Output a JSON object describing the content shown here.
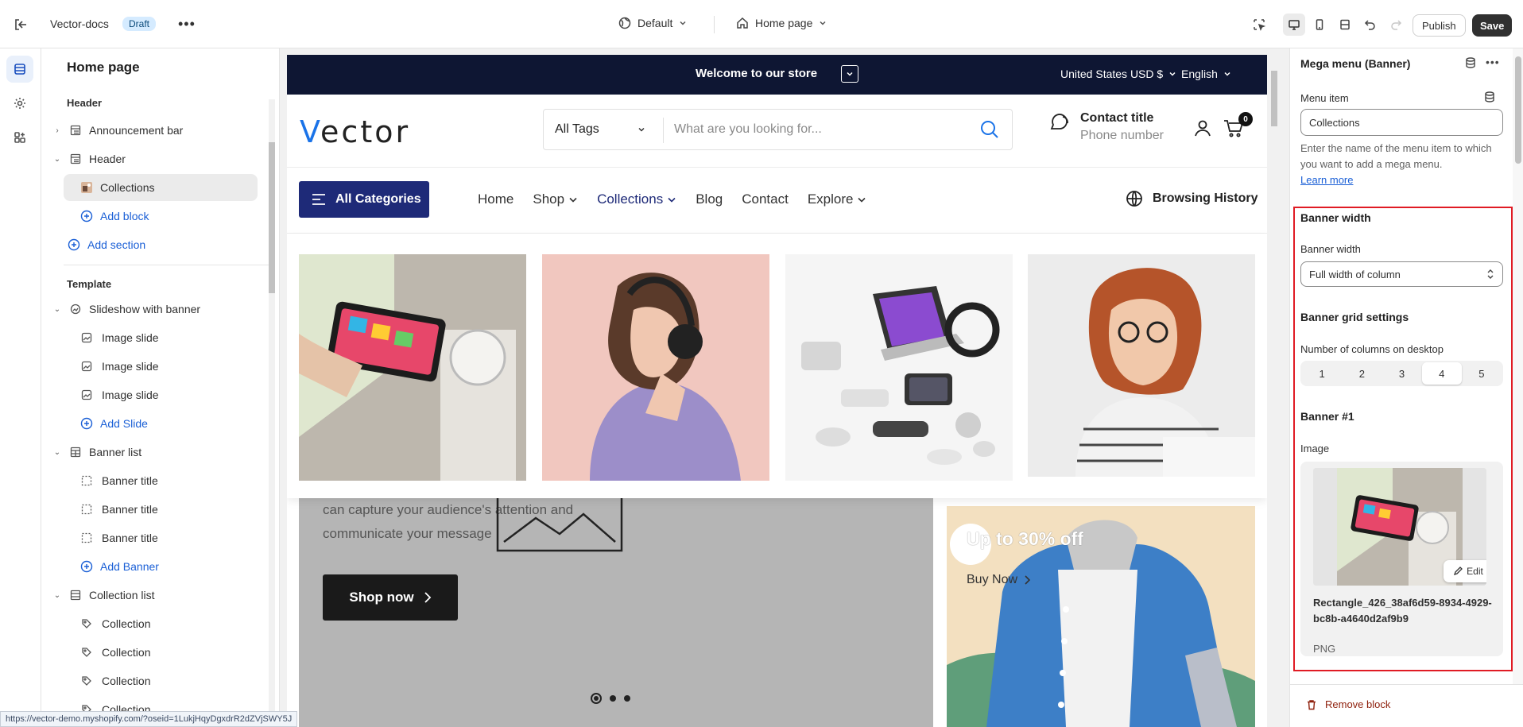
{
  "topbar": {
    "store_name": "Vector-docs",
    "status_badge": "Draft",
    "more": "•••",
    "theme": "Default",
    "page": "Home page",
    "publish_label": "Publish",
    "save_label": "Save"
  },
  "outline": {
    "title": "Home page",
    "header_group": "Header",
    "template_group": "Template",
    "items": {
      "announcement_bar": "Announcement bar",
      "header": "Header",
      "collections": "Collections",
      "add_block": "Add block",
      "add_section": "Add section",
      "slideshow": "Slideshow with banner",
      "image_slide_1": "Image slide",
      "image_slide_2": "Image slide",
      "image_slide_3": "Image slide",
      "add_slide": "Add Slide",
      "banner_list": "Banner list",
      "banner_title_1": "Banner title",
      "banner_title_2": "Banner title",
      "banner_title_3": "Banner title",
      "add_banner": "Add Banner",
      "collection_list": "Collection list",
      "collection_1": "Collection",
      "collection_2": "Collection",
      "collection_3": "Collection",
      "collection_4": "Collection"
    }
  },
  "status_url": "https://vector-demo.myshopify.com/?oseid=1LukjHqyDgxdrR2dZVjSWY5J",
  "site": {
    "announcement": "Welcome to our store",
    "currency": "United States USD $",
    "language": "English",
    "logo_first": "V",
    "logo_rest": "ector",
    "search_category": "All Tags",
    "search_placeholder": "What are you looking for...",
    "contact_title": "Contact title",
    "contact_sub": "Phone number",
    "cart_count": "0",
    "all_categories": "All Categories",
    "nav": {
      "home": "Home",
      "shop": "Shop",
      "collections": "Collections",
      "blog": "Blog",
      "contact": "Contact",
      "explore": "Explore"
    },
    "browsing_history": "Browsing History",
    "hero_line1": "can capture your audience's attention and",
    "hero_line2": "communicate your message",
    "shop_now": "Shop now",
    "promo_title": "Up to 30% off",
    "promo_button": "Buy Now"
  },
  "settings": {
    "title": "Mega menu (Banner)",
    "menu_item_label": "Menu item",
    "menu_item_value": "Collections",
    "help_text": "Enter the name of the menu item to which you want to add a mega menu.",
    "learn_more": "Learn more",
    "banner_width_heading": "Banner width",
    "banner_width_label": "Banner width",
    "banner_width_value": "Full width of column",
    "grid_heading": "Banner grid settings",
    "columns_label": "Number of columns on desktop",
    "columns": [
      "1",
      "2",
      "3",
      "4",
      "5"
    ],
    "columns_selected": "4",
    "banner1_heading": "Banner #1",
    "image_label": "Image",
    "edit_label": "Edit",
    "file_name": "Rectangle_426_38af6d59-8934-4929-bc8b-a4640d2af9b9",
    "file_type": "PNG",
    "remove_block": "Remove block"
  },
  "colors": {
    "announcement_bg": "#0e1633",
    "all_categories_bg": "#1e2a78",
    "accent_blue": "#1a73e8",
    "highlight_box": "#e01b24"
  }
}
